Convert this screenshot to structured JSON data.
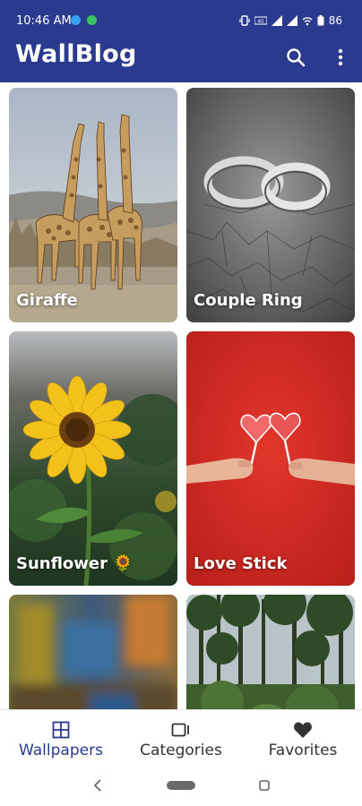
{
  "status_bar": {
    "time": "10:46 AM",
    "battery": "86",
    "icons": [
      "call-status-icon",
      "messenger-icon",
      "vibrate-icon",
      "volte-icon",
      "signal-icon",
      "wifi-icon",
      "battery-icon"
    ]
  },
  "app_bar": {
    "title": "WallBlog",
    "background_color": "#2a3a8f",
    "icons": [
      "search-icon",
      "more-vert-icon"
    ]
  },
  "wallpapers": [
    {
      "label": "Giraffe",
      "icon": "giraffe-image"
    },
    {
      "label": "Couple Ring",
      "icon": "rings-image"
    },
    {
      "label": "Sunflower 🌻",
      "icon": "sunflower-image"
    },
    {
      "label": "Love Stick",
      "icon": "lollipop-image"
    },
    {
      "label": "",
      "icon": "blurred-image"
    },
    {
      "label": "",
      "icon": "forest-image"
    }
  ],
  "bottom_nav": {
    "active_color": "#2a3a8f",
    "inactive_color": "#333333",
    "items": [
      {
        "label": "Wallpapers",
        "icon": "grid-icon",
        "active": true
      },
      {
        "label": "Categories",
        "icon": "categories-icon",
        "active": false
      },
      {
        "label": "Favorites",
        "icon": "heart-icon",
        "active": false
      }
    ]
  },
  "system_nav": {
    "icons": [
      "back-icon",
      "home-pill-icon",
      "recents-icon"
    ]
  }
}
